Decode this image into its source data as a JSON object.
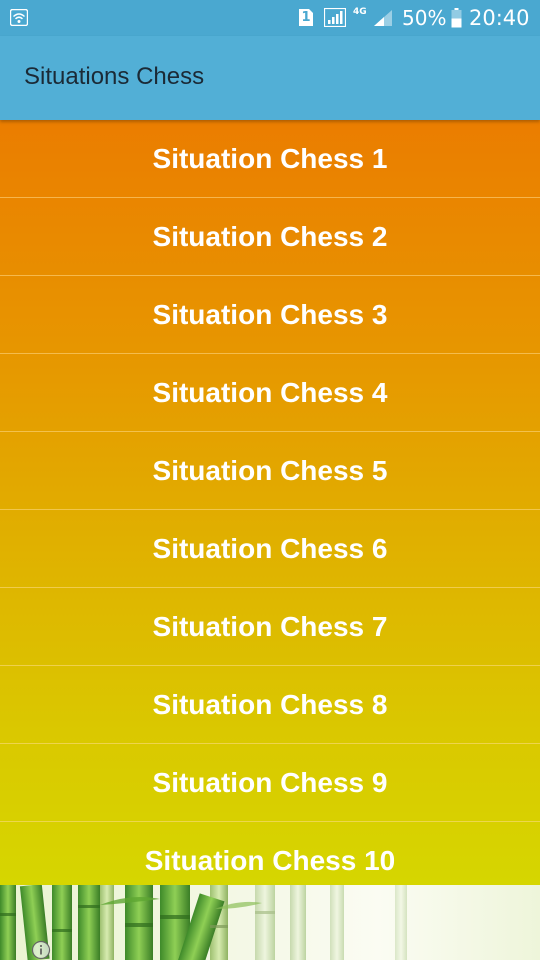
{
  "status_bar": {
    "sim_slot": "1",
    "network_type": "4G",
    "battery_percent": "50%",
    "time": "20:40",
    "icons": [
      "wifi-icon",
      "sim-slot-icon",
      "signal-icon",
      "battery-icon"
    ]
  },
  "app_bar": {
    "title": "Situations Chess"
  },
  "list": {
    "items": [
      {
        "label": "Situation Chess 1"
      },
      {
        "label": "Situation Chess 2"
      },
      {
        "label": "Situation Chess 3"
      },
      {
        "label": "Situation Chess 4"
      },
      {
        "label": "Situation Chess 5"
      },
      {
        "label": "Situation Chess 6"
      },
      {
        "label": "Situation Chess 7"
      },
      {
        "label": "Situation Chess 8"
      },
      {
        "label": "Situation Chess 9"
      },
      {
        "label": "Situation Chess 10"
      }
    ]
  },
  "footer": {
    "image": "bamboo-image",
    "icon": "info-icon"
  },
  "colors": {
    "status_bar": "#4aa8d0",
    "app_bar": "#52afd6",
    "gradient_top": "#eb7d00",
    "gradient_bottom": "#d6d600",
    "item_text": "#ffffff",
    "title_text": "#1b2a36"
  }
}
